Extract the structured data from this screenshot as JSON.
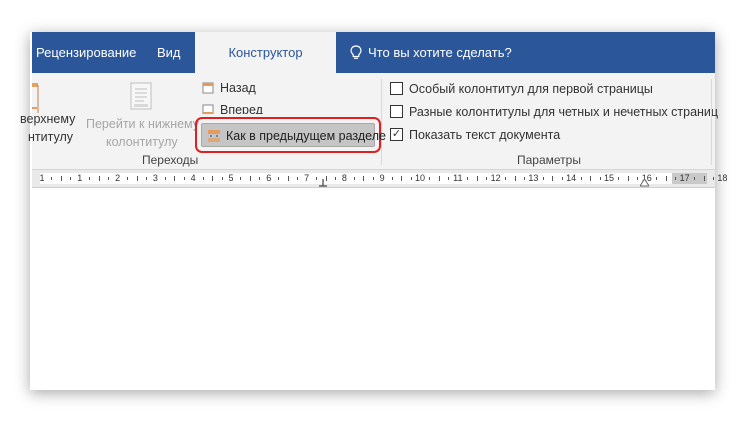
{
  "tabs": {
    "review": "Рецензирование",
    "view": "Вид",
    "designer": "Конструктор",
    "tell_me": "Что вы хотите сделать?"
  },
  "ribbon": {
    "goto_header_partial_1": "верхнему",
    "goto_header_partial_2": "нтитулу",
    "goto_footer_line1": "Перейти к нижнему",
    "goto_footer_line2": "колонтитулу",
    "back": "Назад",
    "forward": "Вперед",
    "link_to_previous": "Как в предыдущем разделе",
    "group_navigation": "Переходы",
    "diff_first_page": "Особый колонтитул для первой страницы",
    "diff_odd_even": "Разные колонтитулы для четных и нечетных страниц",
    "show_doc_text": "Показать текст документа",
    "show_doc_text_checked": "✓",
    "group_options": "Параметры"
  },
  "ruler": {
    "labels": [
      "1",
      "1",
      "2",
      "3",
      "4",
      "5",
      "6",
      "7",
      "8",
      "9",
      "10",
      "11",
      "12",
      "13",
      "14",
      "15",
      "16",
      "17",
      "18"
    ]
  },
  "colors": {
    "accent": "#2b579a",
    "ribbon_bg": "#f3f3f3",
    "highlight_border": "#e02020"
  }
}
